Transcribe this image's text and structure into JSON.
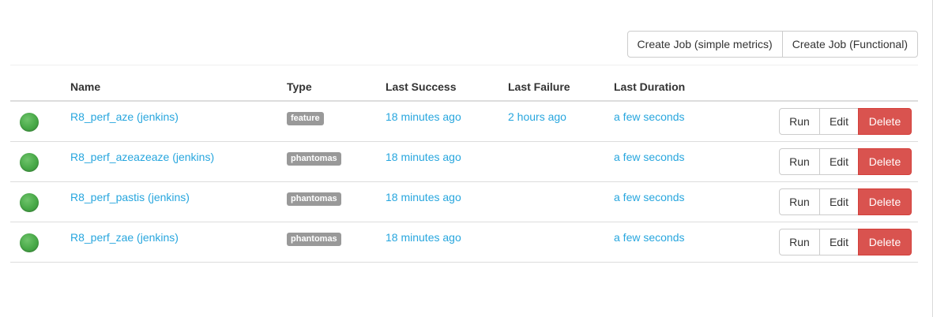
{
  "toolbar": {
    "create_simple": "Create Job (simple metrics)",
    "create_functional": "Create Job (Functional)"
  },
  "table": {
    "headers": [
      "",
      "Name",
      "Type",
      "Last Success",
      "Last Failure",
      "Last Duration",
      ""
    ],
    "rows": [
      {
        "status": "success",
        "name": "R8_perf_aze (jenkins)",
        "type": "feature",
        "last_success": "18 minutes ago",
        "last_failure": "2 hours ago",
        "last_duration": "a few seconds"
      },
      {
        "status": "success",
        "name": "R8_perf_azeazeaze (jenkins)",
        "type": "phantomas",
        "last_success": "18 minutes ago",
        "last_failure": "",
        "last_duration": "a few seconds"
      },
      {
        "status": "success",
        "name": "R8_perf_pastis (jenkins)",
        "type": "phantomas",
        "last_success": "18 minutes ago",
        "last_failure": "",
        "last_duration": "a few seconds"
      },
      {
        "status": "success",
        "name": "R8_perf_zae (jenkins)",
        "type": "phantomas",
        "last_success": "18 minutes ago",
        "last_failure": "",
        "last_duration": "a few seconds"
      }
    ],
    "actions": {
      "run": "Run",
      "edit": "Edit",
      "delete": "Delete"
    }
  },
  "icons": {
    "status": "status-success-icon"
  },
  "colors": {
    "link": "#27a6de",
    "success": "#47a847",
    "danger": "#d9534f",
    "label": "#999999"
  }
}
